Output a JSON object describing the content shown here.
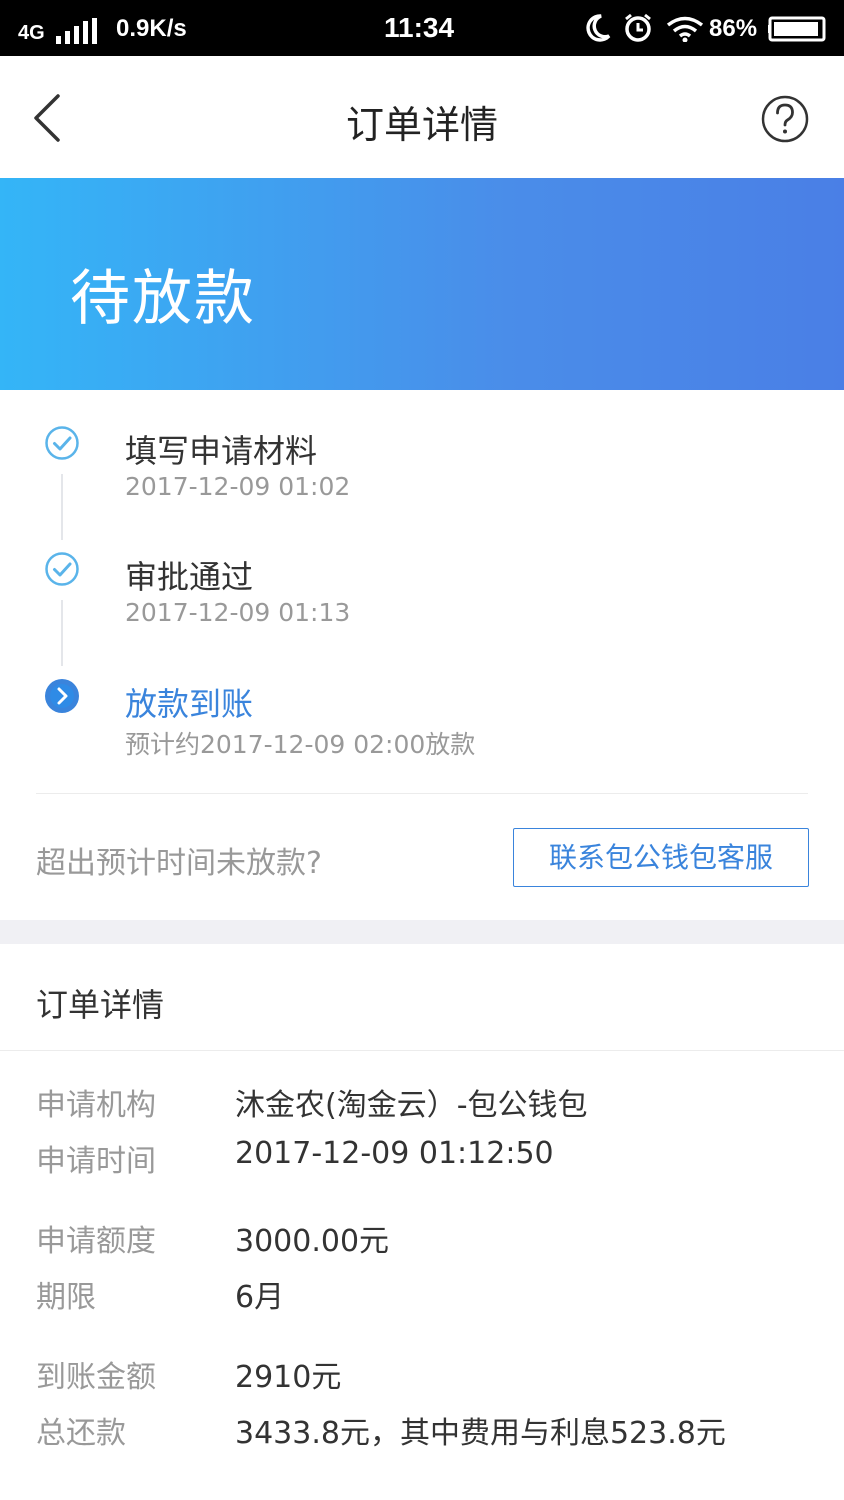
{
  "status_bar": {
    "network": "4G",
    "speed": "0.9K/s",
    "time": "11:34",
    "battery_pct": "86%"
  },
  "nav": {
    "title": "订单详情",
    "back_icon": "chevron-left-icon",
    "help_icon": "question-circle-icon"
  },
  "banner": {
    "status": "待放款",
    "gradient_from": "#34b5f7",
    "gradient_to": "#4a7fe6"
  },
  "timeline": {
    "steps": [
      {
        "title": "填写申请材料",
        "time": "2017-12-09 01:02",
        "state": "done"
      },
      {
        "title": "审批通过",
        "time": "2017-12-09 01:13",
        "state": "done"
      },
      {
        "title": "放款到账",
        "time": "预计约2017-12-09 02:00放款",
        "state": "current"
      }
    ],
    "question": "超出预计时间未放款?",
    "contact_button": "联系包公钱包客服"
  },
  "details": {
    "title": "订单详情",
    "rows": [
      {
        "label": "申请机构",
        "value": "沐金农(淘金云）-包公钱包"
      },
      {
        "label": "申请时间",
        "value": "2017-12-09 01:12:50"
      },
      {
        "label": "申请额度",
        "value": "3000.00元"
      },
      {
        "label": "期限",
        "value": "6月"
      },
      {
        "label": "到账金额",
        "value": "2910元"
      },
      {
        "label": "总还款",
        "value": "3433.8元，其中费用与利息523.8元"
      }
    ]
  },
  "colors": {
    "accent": "#3a84dc",
    "done_icon": "#5ab4ea",
    "muted_text": "#999999"
  }
}
